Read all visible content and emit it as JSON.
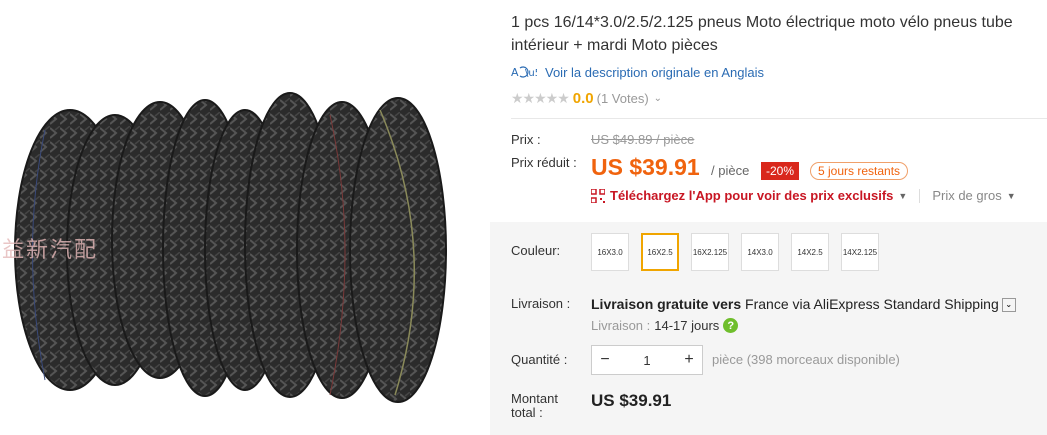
{
  "product": {
    "title": "1 pcs 16/14*3.0/2.5/2.125 pneus Moto électrique moto vélo pneus tube intérieur + mardi Moto pièces",
    "watermark": "益新汽配",
    "translate_icon": "translate-icon",
    "translate_link": "Voir la description originale en Anglais"
  },
  "rating": {
    "stars": "★★★★★",
    "score": "0.0",
    "votes": "(1 Votes)"
  },
  "price": {
    "label": "Prix :",
    "original": "US $49.89 / pièce",
    "reduced_label": "Prix réduit :",
    "reduced": "US $39.91",
    "per": "/ pièce",
    "discount": "-20%",
    "days_left": "5 jours restants"
  },
  "app": {
    "text": "Téléchargez l'App pour voir des prix exclusifs",
    "wholesale": "Prix de gros"
  },
  "color": {
    "label": "Couleur:",
    "options": [
      "16X3.0",
      "16X2.5",
      "16X2.125",
      "14X3.0",
      "14X2.5",
      "14X2.125"
    ],
    "selected_index": 1
  },
  "shipping": {
    "label": "Livraison :",
    "free": "Livraison gratuite vers",
    "destination": " France via AliExpress Standard Shipping",
    "delivery_label": "Livraison :",
    "delivery_value": "14-17 jours"
  },
  "quantity": {
    "label": "Quantité :",
    "value": "1",
    "minus": "−",
    "plus": "+",
    "note": "pièce (398 morceaux disponible)"
  },
  "total": {
    "label": "Montant total :",
    "value": "US $39.91"
  },
  "colors": {
    "price_orange": "#f0630e",
    "discount_red": "#d9281c",
    "link_blue": "#2a6bb3",
    "selected_border": "#f0a500"
  }
}
